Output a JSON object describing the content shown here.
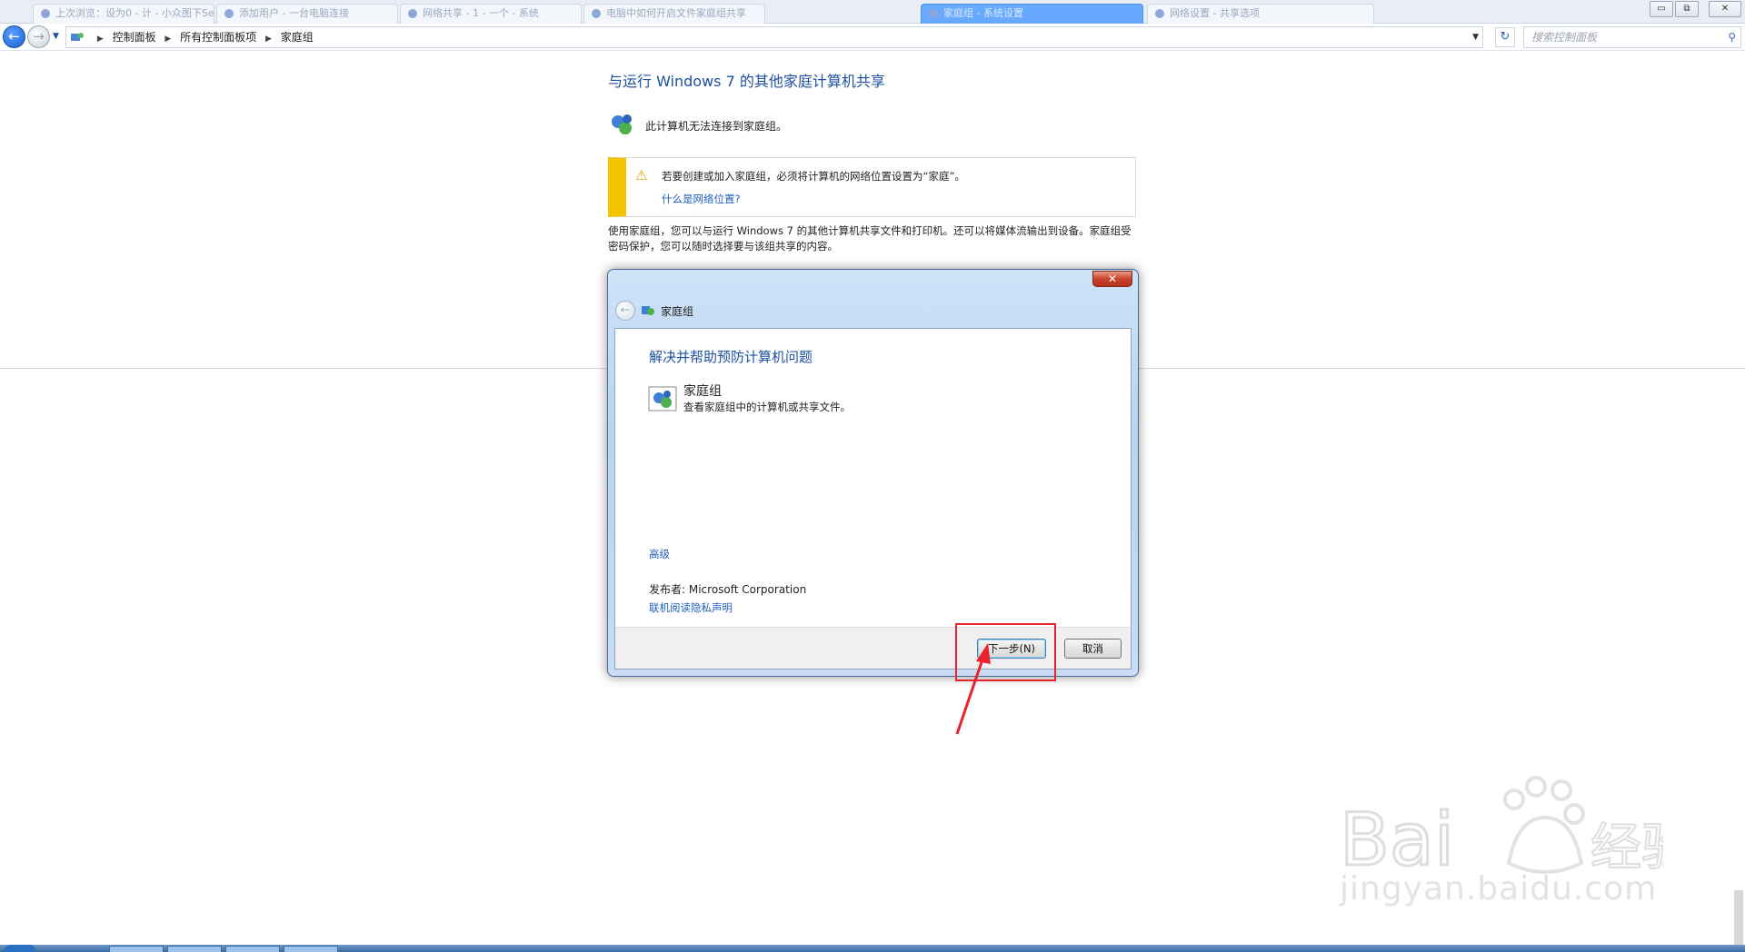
{
  "tabs": [
    {
      "label": "上次浏览：设为0 - 计 - 小众图下Se"
    },
    {
      "label": "添加用户 - 一台电脑连接"
    },
    {
      "label": "网络共享 - 1 - 一个 - 系统"
    },
    {
      "label": "电脑中如何开启文件家庭组共享"
    },
    {
      "label": "家庭组 - 系统设置"
    },
    {
      "label": "网络设置 - 共享选项"
    }
  ],
  "window_controls": {
    "minimize": "▭",
    "maximize": "⧉",
    "close": "✕"
  },
  "breadcrumb": {
    "root": "控制面板",
    "level2": "所有控制面板项",
    "current": "家庭组"
  },
  "search": {
    "placeholder": "搜索控制面板"
  },
  "page": {
    "title": "与运行 Windows 7 的其他家庭计算机共享",
    "status": "此计算机无法连接到家庭组。",
    "warning": "若要创建或加入家庭组，必须将计算机的网络位置设置为“家庭”。",
    "warning_link": "什么是网络位置?",
    "description": "使用家庭组，您可以与运行 Windows 7 的其他计算机共享文件和打印机。还可以将媒体流输出到设备。家庭组受密码保护，您可以随时选择要与该组共享的内容。"
  },
  "dialog": {
    "nav_title": "家庭组",
    "heading": "解决并帮助预防计算机问题",
    "item_title": "家庭组",
    "item_desc": "查看家庭组中的计算机或共享文件。",
    "advanced_link": "高级",
    "publisher": "发布者:  Microsoft Corporation",
    "privacy_link": "联机阅读隐私声明",
    "next_button": "下一步(N)",
    "cancel_button": "取消",
    "close_glyph": "✕"
  },
  "watermark": {
    "domain_text": "jingyan.baidu.com"
  },
  "colors": {
    "link": "#1f5fbf",
    "title": "#1e50a2",
    "warning_bar": "#f4c400",
    "annotation": "#e8232b"
  }
}
